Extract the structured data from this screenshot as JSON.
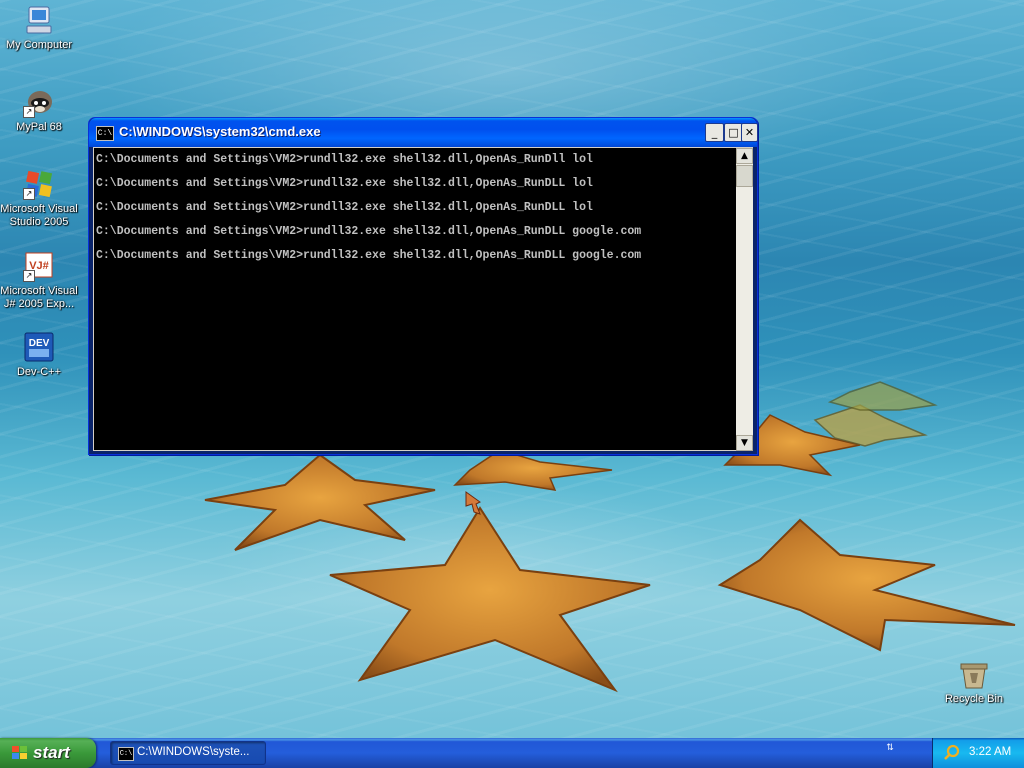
{
  "desktop": {
    "icons": [
      {
        "label": "My Computer",
        "icon": "computer-icon"
      },
      {
        "label": "MyPal 68",
        "icon": "raccoon-icon"
      },
      {
        "label": "Microsoft Visual Studio 2005",
        "icon": "visual-studio-icon"
      },
      {
        "label": "Microsoft Visual J# 2005 Exp...",
        "icon": "visual-jsharp-icon"
      },
      {
        "label": "Dev-C++",
        "icon": "dev-cpp-icon"
      },
      {
        "label": "Recycle Bin",
        "icon": "recycle-bin-icon"
      }
    ],
    "vjs_badge": "VJ#",
    "dev_badge": "DEV"
  },
  "cmd_window": {
    "title": "C:\\WINDOWS\\system32\\cmd.exe",
    "icon_text": "C:\\",
    "min_label": "_",
    "max_label": "□",
    "close_label": "✕",
    "lines": [
      "C:\\Documents and Settings\\VM2>rundll32.exe shell32.dll,OpenAs_RunDll lol",
      "C:\\Documents and Settings\\VM2>rundll32.exe shell32.dll,OpenAs_RunDLL lol",
      "C:\\Documents and Settings\\VM2>rundll32.exe shell32.dll,OpenAs_RunDLL lol",
      "C:\\Documents and Settings\\VM2>rundll32.exe shell32.dll,OpenAs_RunDLL google.com",
      "C:\\Documents and Settings\\VM2>rundll32.exe shell32.dll,OpenAs_RunDLL google.com"
    ],
    "scroll_up": "▲",
    "scroll_down": "▼"
  },
  "taskbar": {
    "start_label": "start",
    "task_button_label": "C:\\WINDOWS\\syste...",
    "task_icon_text": "C:\\",
    "lang_glyph": "⇅",
    "clock": "3:22 AM"
  },
  "colors": {
    "console_bg": "#000000",
    "console_text": "#c0c0c0",
    "titlebar_blue": "#0053ee",
    "taskbar_blue": "#245edb",
    "start_green": "#3a993a",
    "tray_blue": "#18b9f0"
  }
}
